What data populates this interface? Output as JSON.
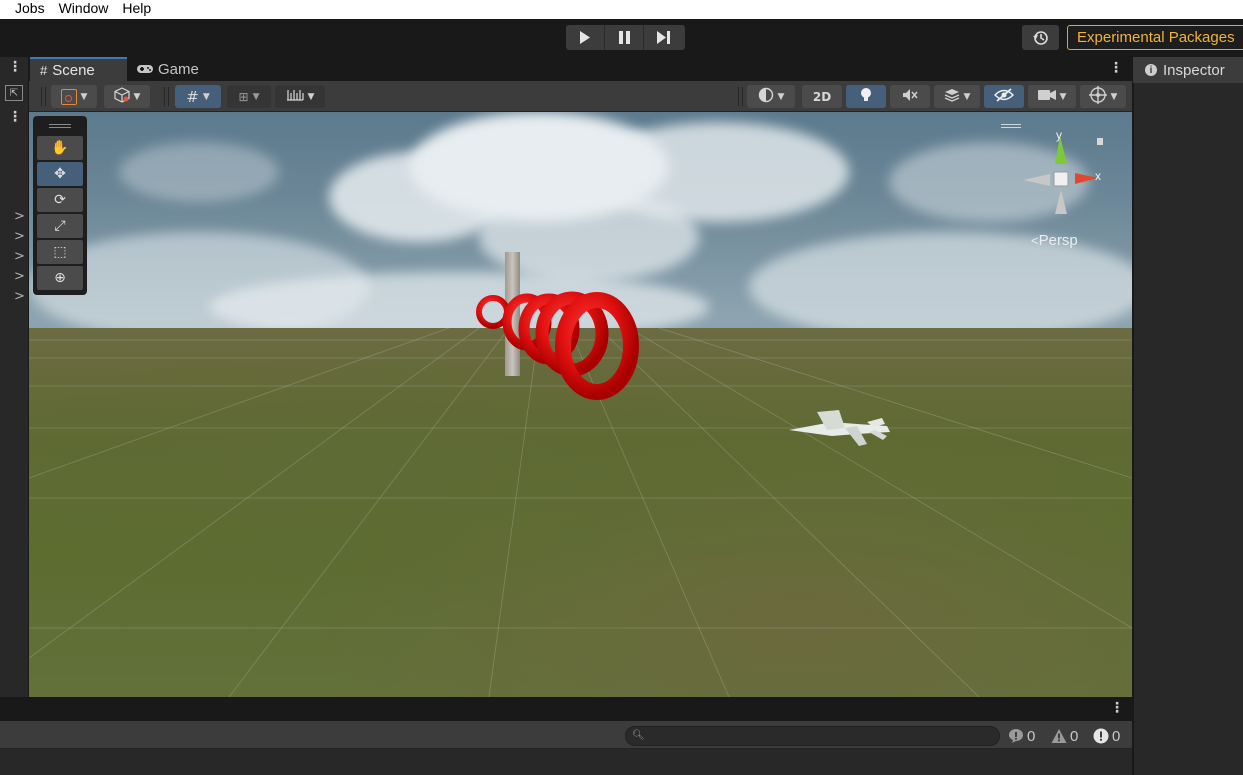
{
  "menu": [
    "Jobs",
    "Window",
    "Help"
  ],
  "toolbar": {
    "play_icon": "play-icon",
    "pause_icon": "pause-icon",
    "step_icon": "step-icon",
    "history_icon": "history-icon",
    "experimental_label": "Experimental Packages",
    "accent_color": "#e3a533"
  },
  "tabs": [
    {
      "label": "Scene",
      "icon": "grid-icon",
      "active": true
    },
    {
      "label": "Game",
      "icon": "gamepad-icon",
      "active": false
    }
  ],
  "scene_toolbar": {
    "mode_2d_label": "2D"
  },
  "tools": [
    "hand-tool",
    "move-tool",
    "rotate-tool",
    "scale-tool",
    "rect-tool",
    "transform-tool"
  ],
  "selected_tool": "move-tool",
  "gizmo": {
    "y_label": "y",
    "x_label": "x",
    "projection_label": "Persp",
    "x_color": "#e0492e",
    "y_color": "#7ec83a"
  },
  "inspector": {
    "title": "Inspector"
  },
  "console": {
    "search_placeholder": "",
    "log_count": "0",
    "warning_count": "0",
    "error_count": "0"
  }
}
